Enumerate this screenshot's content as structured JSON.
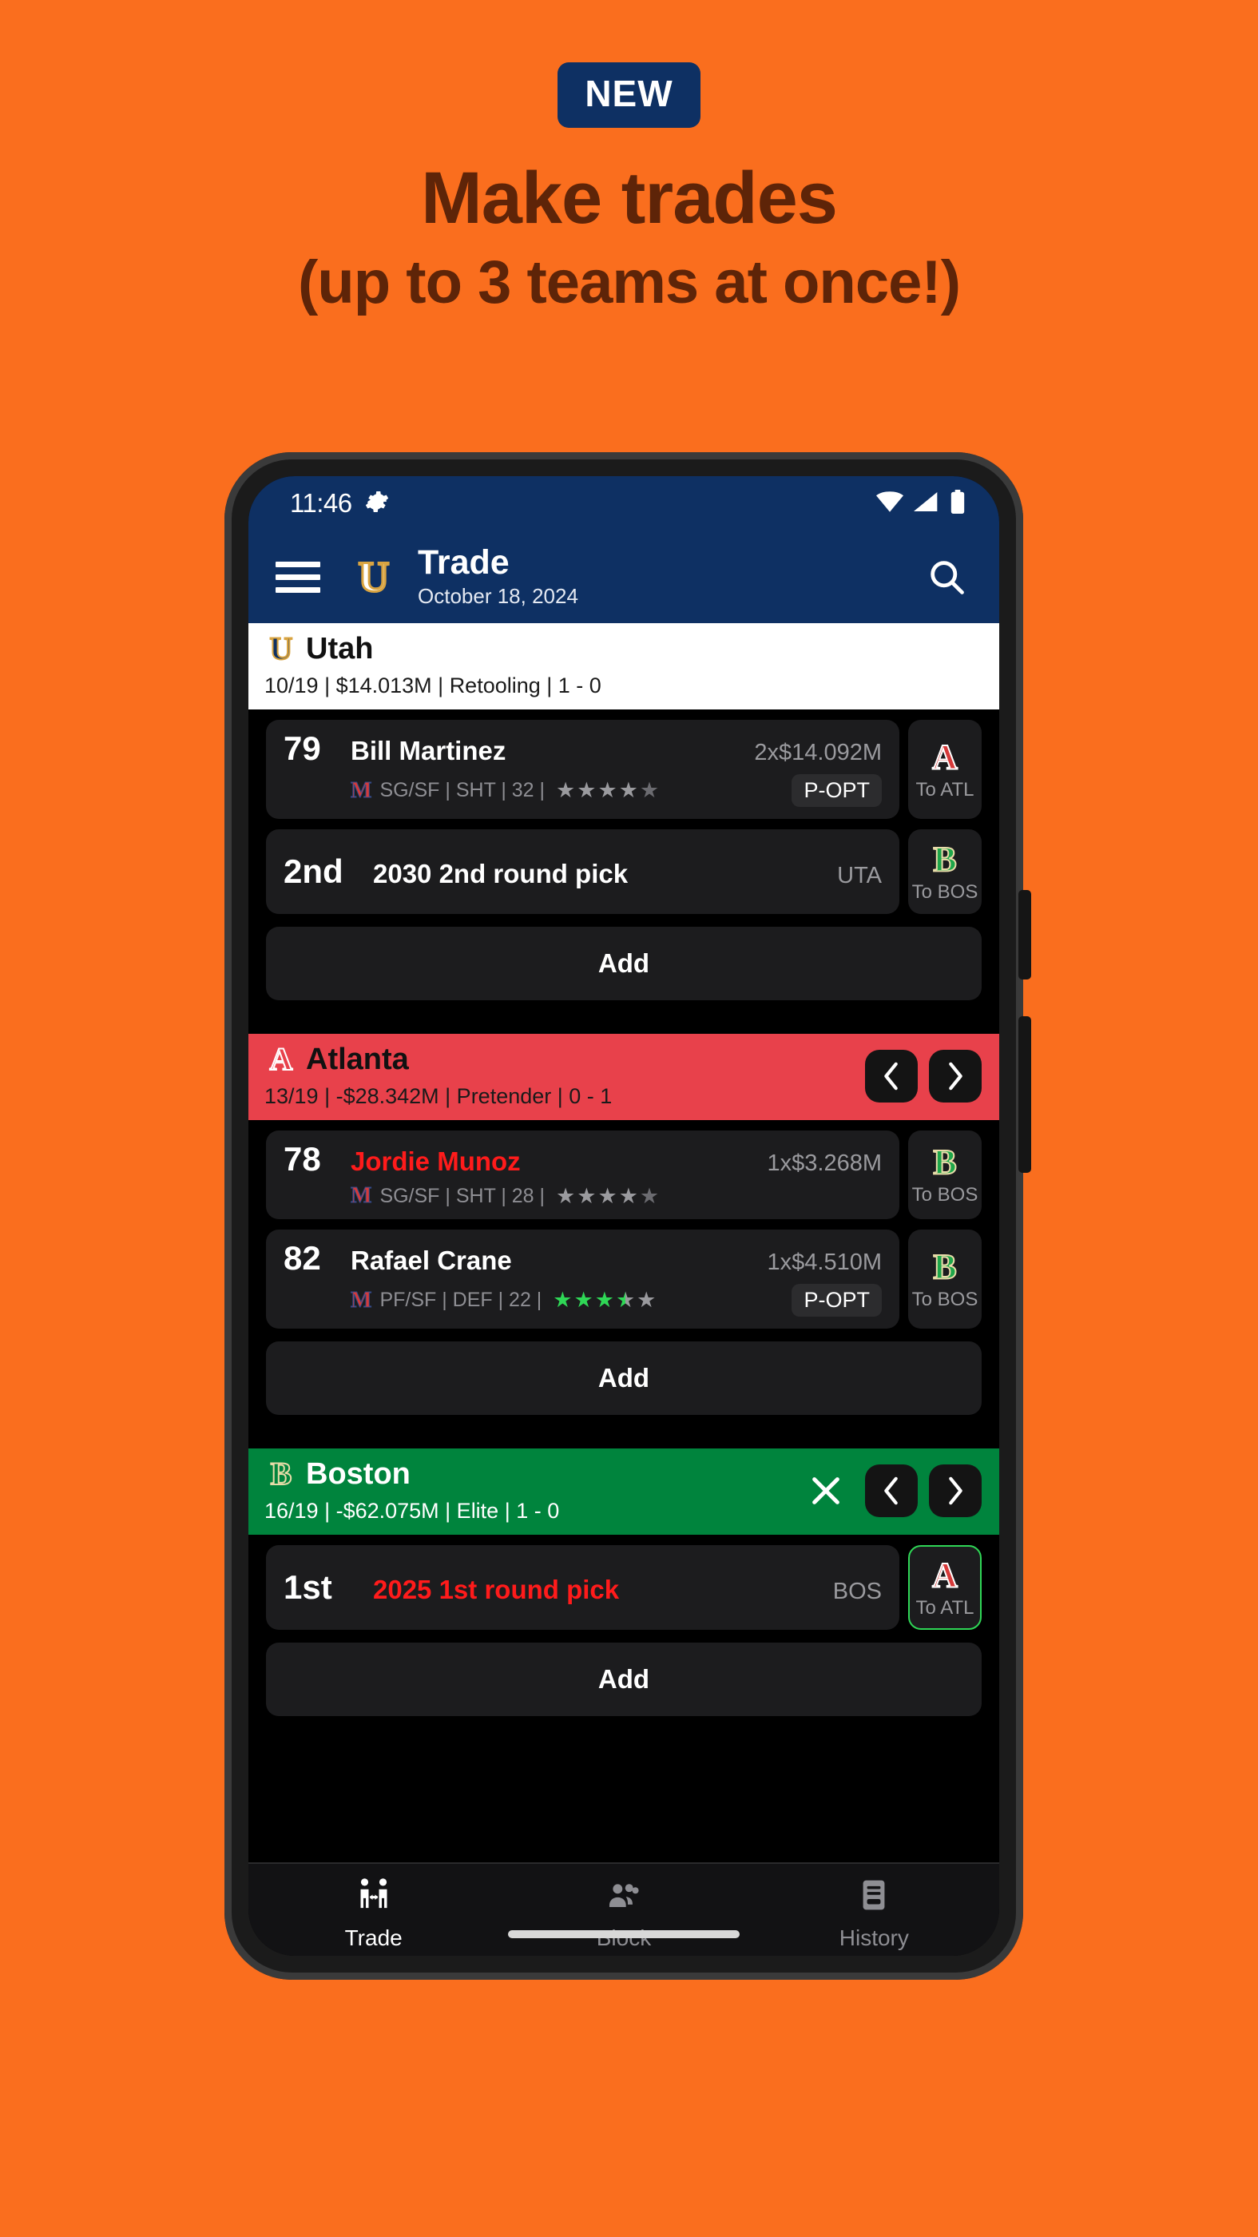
{
  "promo": {
    "badge": "NEW",
    "headline": "Make trades",
    "subheadline": "(up to 3 teams at once!)",
    "bg_color": "#FA6E1E",
    "text_color": "#5E2408",
    "badge_bg": "#0E3063"
  },
  "statusbar": {
    "time": "11:46",
    "gear_icon": "gear-icon",
    "wifi_icon": "wifi-icon",
    "signal_icon": "signal-icon",
    "battery_icon": "battery-icon"
  },
  "appbar": {
    "menu_icon": "hamburger-menu-icon",
    "logo": "U",
    "title": "Trade",
    "date": "October 18, 2024",
    "search_icon": "search-icon",
    "bg_color": "#0E3063"
  },
  "teams": [
    {
      "id": "utah",
      "logo": "U",
      "name": "Utah",
      "meta": "10/19 | $14.013M | Retooling | 1 - 0",
      "bg_color": "#FFFFFF",
      "text_style": "dark",
      "has_close": false,
      "has_nav": false,
      "assets": [
        {
          "kind": "player",
          "ovr": "79",
          "name": "Bill Martinez",
          "name_color": "white",
          "salary": "2x$14.092M",
          "team_badge": "M",
          "detail": "SG/SF | SHT | 32 |",
          "stars": [
            "gray",
            "gray",
            "gray",
            "gray",
            "dgray"
          ],
          "option": "P-OPT",
          "dest_logo": "A",
          "dest_logo_style": "atl",
          "dest_label": "To ATL",
          "dest_bordered": false
        },
        {
          "kind": "pick",
          "round": "2nd",
          "name": "2030 2nd round pick",
          "name_color": "white",
          "owner": "UTA",
          "dest_logo": "B",
          "dest_logo_style": "bos",
          "dest_label": "To BOS",
          "dest_bordered": false
        }
      ],
      "add_label": "Add"
    },
    {
      "id": "atlanta",
      "logo": "A",
      "name": "Atlanta",
      "meta": "13/19 | -$28.342M | Pretender | 0 - 1",
      "bg_color": "#E8414B",
      "text_style": "dark",
      "has_close": false,
      "has_nav": true,
      "assets": [
        {
          "kind": "player",
          "ovr": "78",
          "name": "Jordie Munoz",
          "name_color": "red",
          "salary": "1x$3.268M",
          "team_badge": "M",
          "detail": "SG/SF | SHT | 28 |",
          "stars": [
            "gray",
            "gray",
            "gray",
            "gray",
            "dgray"
          ],
          "option": "",
          "dest_logo": "B",
          "dest_logo_style": "bos",
          "dest_label": "To BOS",
          "dest_bordered": false
        },
        {
          "kind": "player",
          "ovr": "82",
          "name": "Rafael Crane",
          "name_color": "white",
          "salary": "1x$4.510M",
          "team_badge": "M",
          "detail": "PF/SF | DEF | 22 |",
          "stars": [
            "green",
            "green",
            "green",
            "half",
            "gray"
          ],
          "option": "P-OPT",
          "dest_logo": "B",
          "dest_logo_style": "bos",
          "dest_label": "To BOS",
          "dest_bordered": false
        }
      ],
      "add_label": "Add"
    },
    {
      "id": "boston",
      "logo": "B",
      "name": "Boston",
      "meta": "16/19 | -$62.075M | Elite | 1 - 0",
      "bg_color": "#00843D",
      "text_style": "light",
      "has_close": true,
      "has_nav": true,
      "assets": [
        {
          "kind": "pick",
          "round": "1st",
          "name": "2025 1st round pick",
          "name_color": "red",
          "owner": "BOS",
          "dest_logo": "A",
          "dest_logo_style": "atl",
          "dest_label": "To ATL",
          "dest_bordered": true
        }
      ],
      "add_label": "Add"
    }
  ],
  "bottomnav": {
    "items": [
      {
        "label": "Trade",
        "icon": "trade-handshake-icon",
        "active": true
      },
      {
        "label": "Block",
        "icon": "people-group-icon",
        "active": false
      },
      {
        "label": "History",
        "icon": "book-icon",
        "active": false
      }
    ]
  }
}
